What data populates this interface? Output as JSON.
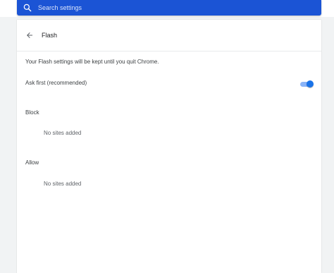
{
  "search": {
    "placeholder": "Search settings"
  },
  "page": {
    "title": "Flash",
    "note": "Your Flash settings will be kept until you quit Chrome."
  },
  "ask_first": {
    "label": "Ask first (recommended)",
    "enabled": true
  },
  "block": {
    "heading": "Block",
    "empty_text": "No sites added"
  },
  "allow": {
    "heading": "Allow",
    "empty_text": "No sites added"
  },
  "icons": {
    "search": "search-icon",
    "back": "arrow-back-icon"
  },
  "colors": {
    "search_bar": "#1b54d5",
    "toggle_on": "#1a73e8",
    "page_background": "#f1f3f4"
  }
}
